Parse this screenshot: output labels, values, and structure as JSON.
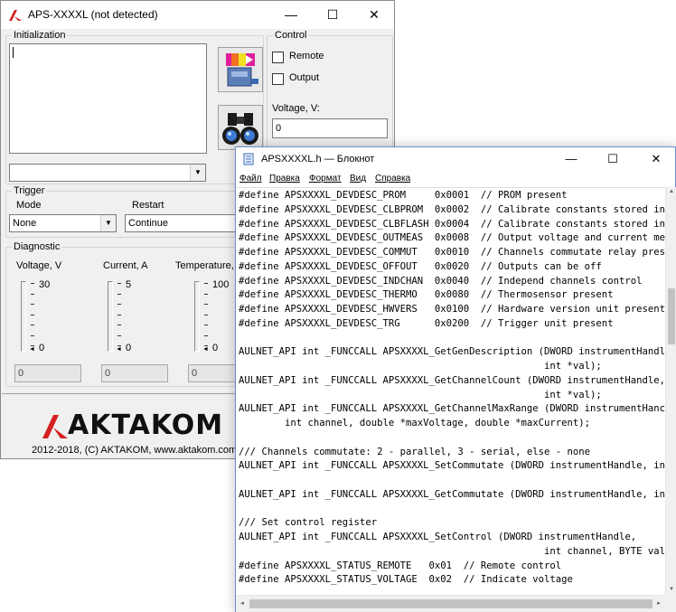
{
  "aps": {
    "title": "APS-XXXXL (not detected)",
    "controls": {
      "minimize": "—",
      "maximize": "☐",
      "close": "✕"
    },
    "init_group": "Initialization",
    "init_text": "",
    "port_select": "",
    "control_group": "Control",
    "remote_label": "Remote",
    "remote_checked": false,
    "output_label": "Output",
    "output_checked": false,
    "voltage_label": "Voltage, V:",
    "voltage_value": "0",
    "trigger_group": "Trigger",
    "mode_label": "Mode",
    "mode_value": "None",
    "restart_label": "Restart",
    "restart_value": "Continue",
    "diag_group": "Diagnostic",
    "gauges": [
      {
        "label": "Voltage, V",
        "max": "30",
        "min": "0",
        "readout": "0"
      },
      {
        "label": "Current, A",
        "max": "5",
        "min": "0",
        "readout": "0"
      },
      {
        "label": "Temperature,",
        "max": "100",
        "min": "0",
        "readout": "0"
      }
    ],
    "logo": "AKTAKOM",
    "copyright": "2012-2018, (C) AKTAKOM, www.aktakom.com"
  },
  "notepad": {
    "title": "APSXXXXL.h — Блокнот",
    "controls": {
      "minimize": "—",
      "maximize": "☐",
      "close": "✕"
    },
    "menu": [
      "Файл",
      "Правка",
      "Формат",
      "Вид",
      "Справка"
    ],
    "lines": [
      "#define APSXXXXL_DEVDESC_PROM     0x0001  // PROM present",
      "#define APSXXXXL_DEVDESC_CLBPROM  0x0002  // Calibrate constants stored in",
      "#define APSXXXXL_DEVDESC_CLBFLASH 0x0004  // Calibrate constants stored in",
      "#define APSXXXXL_DEVDESC_OUTMEAS  0x0008  // Output voltage and current me",
      "#define APSXXXXL_DEVDESC_COMMUT   0x0010  // Channels commutate relay pres",
      "#define APSXXXXL_DEVDESC_OFFOUT   0x0020  // Outputs can be off",
      "#define APSXXXXL_DEVDESC_INDCHAN  0x0040  // Independ channels control",
      "#define APSXXXXL_DEVDESC_THERMO   0x0080  // Thermosensor present",
      "#define APSXXXXL_DEVDESC_HWVERS   0x0100  // Hardware version unit present",
      "#define APSXXXXL_DEVDESC_TRG      0x0200  // Trigger unit present",
      "",
      "AULNET_API int _FUNCCALL APSXXXXL_GetGenDescription (DWORD instrumentHandl",
      "                                                     int *val);",
      "AULNET_API int _FUNCCALL APSXXXXL_GetChannelCount (DWORD instrumentHandle,",
      "                                                     int *val);",
      "AULNET_API int _FUNCCALL APSXXXXL_GetChannelMaxRange (DWORD instrumentHanc",
      "        int channel, double *maxVoltage, double *maxCurrent);",
      "",
      "/// Channels commutate: 2 - parallel, 3 - serial, else - none",
      "AULNET_API int _FUNCCALL APSXXXXL_SetCommutate (DWORD instrumentHandle, in",
      "",
      "AULNET_API int _FUNCCALL APSXXXXL_GetCommutate (DWORD instrumentHandle, in",
      "",
      "/// Set control register",
      "AULNET_API int _FUNCCALL APSXXXXL_SetControl (DWORD instrumentHandle,",
      "                                                     int channel, BYTE val);",
      "#define APSXXXXL_STATUS_REMOTE   0x01  // Remote control",
      "#define APSXXXXL_STATUS_VOLTAGE  0x02  // Indicate voltage"
    ]
  },
  "colors": {
    "logo_red": "#d42020",
    "scroll_thumb": "#c2c2c2",
    "window_bg": "#f0f0f0"
  }
}
